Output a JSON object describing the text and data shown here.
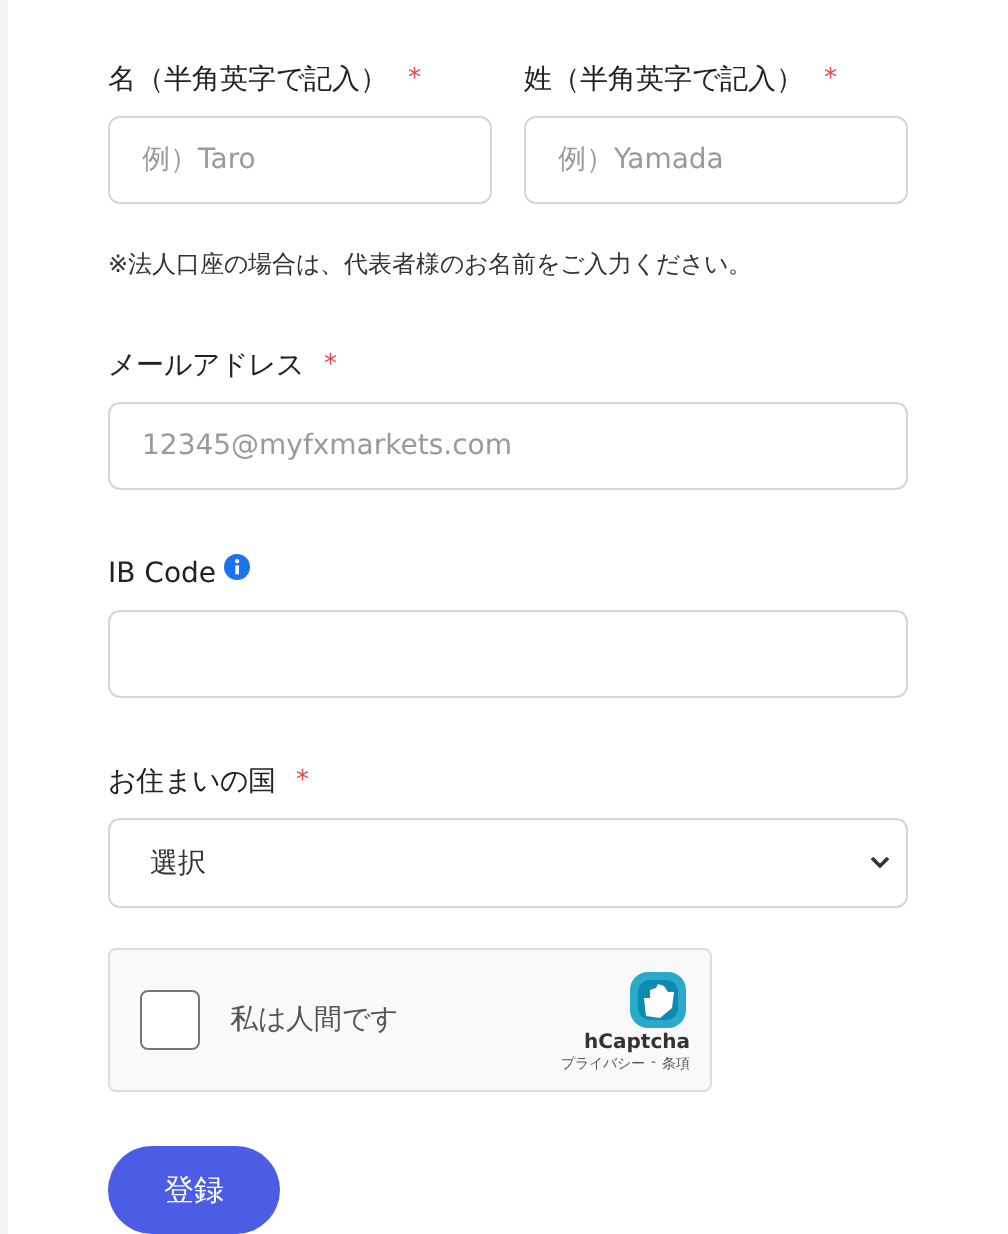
{
  "name_fields": [
    {
      "label": "名（半角英字で記入）",
      "required_mark": "*",
      "placeholder": "例）Taro"
    },
    {
      "label": "姓（半角英字で記入）",
      "required_mark": "*",
      "placeholder": "例）Yamada"
    }
  ],
  "note": "※法人口座の場合は、代表者様のお名前をご入力ください。",
  "fields": [
    {
      "kind": "input",
      "label": "メールアドレス",
      "required_mark": "*",
      "info": false,
      "placeholder": "12345@myfxmarkets.com"
    },
    {
      "kind": "input",
      "label": "IB Code",
      "info": true
    },
    {
      "kind": "select",
      "label": "お住まいの国",
      "required_mark": "*",
      "info": false,
      "value": "選択"
    }
  ],
  "captcha": {
    "label": "私は人間です",
    "checked": false,
    "brand": "hCaptcha",
    "privacy_link": "プライバシー",
    "separator": "-",
    "terms_link": "条項"
  },
  "submit": "登録"
}
